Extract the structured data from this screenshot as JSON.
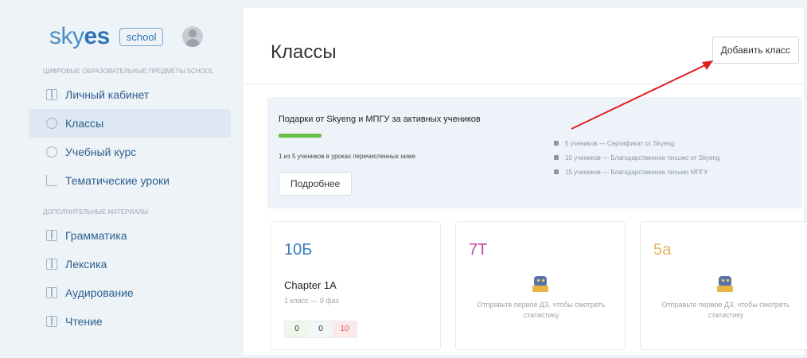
{
  "brand": {
    "logo_prefix": "sky",
    "logo_accent": "es",
    "badge": "school"
  },
  "sidebar": {
    "caption_main": "ЦИФРОВЫЕ ОБРАЗОВАТЕЛЬНЫЕ ПРЕДМЕТЫ SCHOOL",
    "items": [
      {
        "label": "Личный кабинет",
        "icon": "book-icon"
      },
      {
        "label": "Классы",
        "icon": "graduation-cap-icon",
        "active": true
      },
      {
        "label": "Учебный курс",
        "icon": "circle-icon"
      },
      {
        "label": "Тематические уроки",
        "icon": "tree-icon"
      }
    ],
    "caption_extra": "ДОПОЛНИТЕЛЬНЫЕ МАТЕРИАЛЫ",
    "extra_items": [
      {
        "label": "Грамматика",
        "icon": "book-icon"
      },
      {
        "label": "Лексика",
        "icon": "book-icon"
      },
      {
        "label": "Аудирование",
        "icon": "book-icon"
      },
      {
        "label": "Чтение",
        "icon": "book-icon"
      }
    ]
  },
  "header": {
    "title": "Классы",
    "add_button": "Добавить класс"
  },
  "gift": {
    "title": "Подарки от Skyeng и МПГУ за активных учеников",
    "progress": 0.2,
    "progress_color": "#6ac04a",
    "note": "1 из 5 учеников в уроках перечисленных ниже",
    "more_button": "Подробнее",
    "rewards": [
      "5 учеников — Сертификат от Skyeng",
      "10 учеников — Благодарственное письмо от Skyeng",
      "15 учеников — Благодарственное письмо МПГУ"
    ]
  },
  "classes": [
    {
      "name": "10Б",
      "chapter": "Chapter 1A",
      "meta": "1 класс — 9 фаз",
      "stats": [
        "0",
        "0",
        "10"
      ]
    },
    {
      "name": "7Т",
      "empty_note": "Отправьте первое ДЗ, чтобы смотреть статистику"
    },
    {
      "name": "5а",
      "empty_note": "Отправьте первое ДЗ, чтобы смотреть статистику"
    }
  ],
  "colors": {
    "accent": "#2f73b6",
    "arrow": "#e02020"
  }
}
